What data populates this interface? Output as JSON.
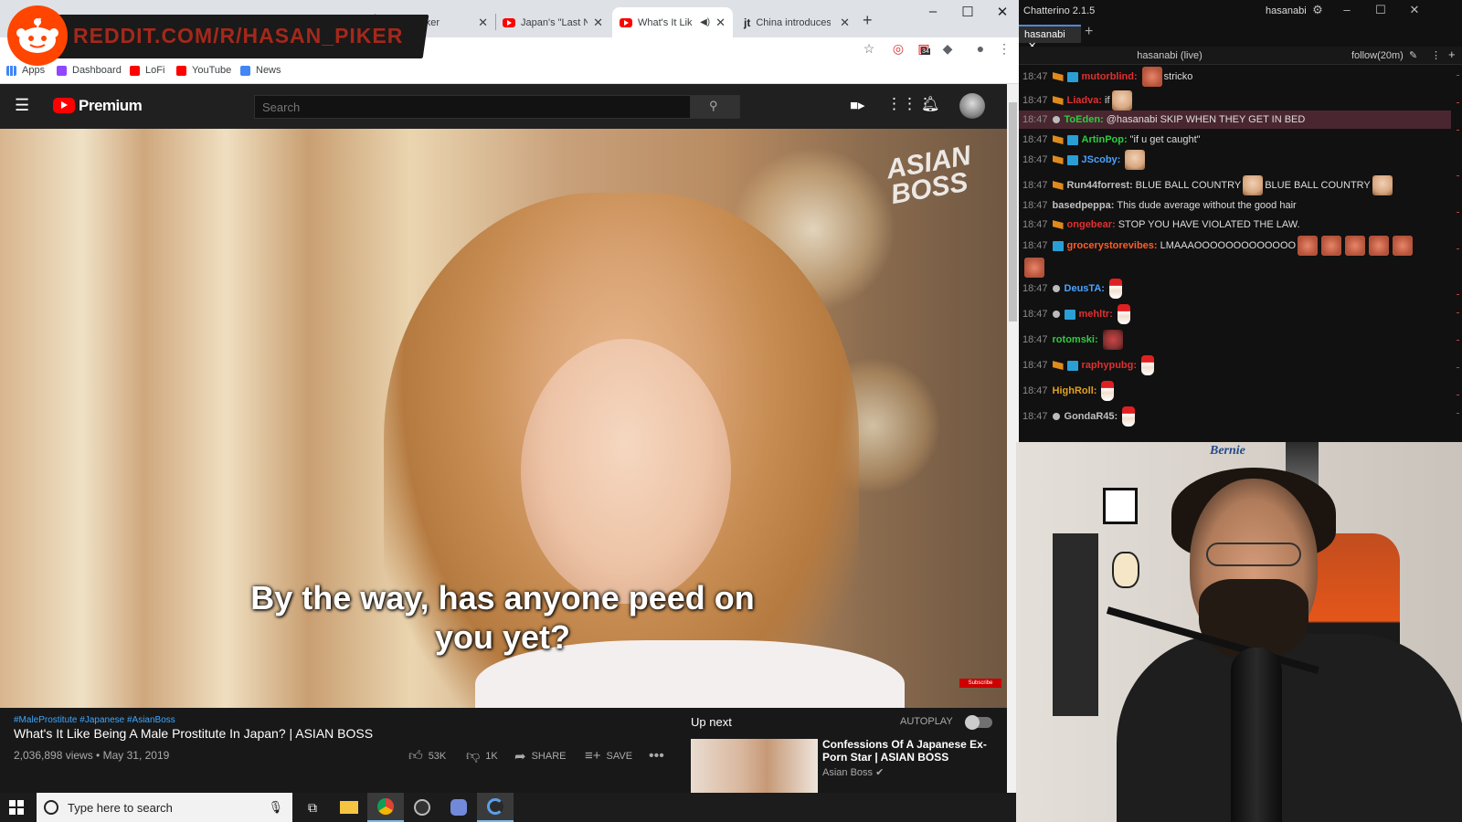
{
  "browser": {
    "tabs": [
      {
        "label": "Piker",
        "icon": "reddit-favicon"
      },
      {
        "label": "Japan's \"Last Ninja",
        "icon": "youtube-favicon"
      },
      {
        "label": "What's It Like",
        "icon": "youtube-favicon",
        "active": true,
        "muted": true
      },
      {
        "label": "China introduces",
        "icon": "jt-favicon"
      }
    ],
    "bookmarks": [
      {
        "label": "Apps",
        "icon": "apps-grid-icon",
        "color": "#4285f4"
      },
      {
        "label": "Dashboard",
        "icon": "twitch-icon",
        "color": "#9146ff"
      },
      {
        "label": "LoFi",
        "icon": "youtube-icon",
        "color": "#ff0000"
      },
      {
        "label": "YouTube",
        "icon": "youtube-icon",
        "color": "#ff0000"
      },
      {
        "label": "News",
        "icon": "google-news-icon",
        "color": "#4285f4"
      }
    ],
    "extension_badge": "34"
  },
  "overlay": {
    "reddit_text": "REDDIT.COM/R/HASAN_PIKER"
  },
  "youtube": {
    "logo_text": "Premium",
    "search_placeholder": "Search",
    "video": {
      "watermark": "ASIAN BOSS",
      "subtitle": "By the way, has anyone peed on you yet?",
      "subscribe_label": "Subscribe",
      "hashtags": "#MaleProstitute #Japanese #AsianBoss",
      "title": "What's It Like Being A Male Prostitute In Japan? | ASIAN BOSS",
      "views": "2,036,898 views • May 31, 2019",
      "likes": "53K",
      "dislikes": "1K",
      "share_label": "SHARE",
      "save_label": "SAVE"
    },
    "up_next": {
      "heading": "Up next",
      "autoplay_label": "AUTOPLAY",
      "autoplay_on": false,
      "item_title": "Confessions Of A Japanese Ex-Porn Star | ASIAN BOSS",
      "item_channel": "Asian Boss"
    }
  },
  "chatterino": {
    "title": "Chatterino 2.1.5",
    "user": "hasanabi",
    "tab": "hasanabi",
    "channel_header": "hasanabi (live)",
    "follow_mode": "follow(20m)",
    "messages": [
      {
        "time": "18:47",
        "nick": "mutorblind:",
        "color": "#e03030",
        "text": "stricko",
        "badges": [
          "sub",
          "prime"
        ],
        "emotes": [
          "rage"
        ]
      },
      {
        "time": "18:47",
        "nick": "Liadva:",
        "color": "#e03030",
        "text": "if",
        "badges": [
          "sub"
        ],
        "emotes_after": [
          "face"
        ]
      },
      {
        "time": "18:47",
        "nick": "ToEden:",
        "color": "#2ecc40",
        "text": "@hasanabi SKIP WHEN THEY GET IN BED",
        "badges": [
          "small"
        ],
        "highlight": true
      },
      {
        "time": "18:47",
        "nick": "ArtinPop:",
        "color": "#2ecc40",
        "text": "\"if u get caught\"",
        "badges": [
          "sub",
          "prime"
        ]
      },
      {
        "time": "18:47",
        "nick": "JScoby:",
        "color": "#4aa3ff",
        "text": "",
        "badges": [
          "sub",
          "prime"
        ],
        "emotes_after": [
          "face"
        ]
      },
      {
        "time": "18:47",
        "nick": "Run44forrest:",
        "color": "#c0c0c0",
        "text": "BLUE BALL COUNTRY",
        "text2": "BLUE BALL COUNTRY",
        "badges": [
          "sub"
        ]
      },
      {
        "time": "18:47",
        "nick": "basedpeppa:",
        "color": "#c0c0c0",
        "text": "This dude average without the good hair",
        "badges": []
      },
      {
        "time": "18:47",
        "nick": "ongebear:",
        "color": "#e03030",
        "text": "STOP YOU HAVE VIOLATED THE LAW.",
        "badges": [
          "sub"
        ]
      },
      {
        "time": "18:47",
        "nick": "grocerystorevibes:",
        "color": "#ff5d2a",
        "text": "LMAAAOOOOOOOOOOOOO",
        "badges": [
          "prime"
        ]
      },
      {
        "time": "18:47",
        "nick": "DeusTA:",
        "color": "#4aa3ff",
        "text": "",
        "badges": [
          "small"
        ]
      },
      {
        "time": "18:47",
        "nick": "mehltr:",
        "color": "#e03030",
        "text": "",
        "badges": [
          "small",
          "prime"
        ]
      },
      {
        "time": "18:47",
        "nick": "rotomski:",
        "color": "#2ecc40",
        "text": "",
        "badges": []
      },
      {
        "time": "18:47",
        "nick": "raphypubg:",
        "color": "#e03030",
        "text": "",
        "badges": [
          "sub",
          "prime"
        ]
      },
      {
        "time": "18:47",
        "nick": "HighRoll:",
        "color": "#e0a020",
        "text": "",
        "badges": []
      },
      {
        "time": "18:47",
        "nick": "GondaR45:",
        "color": "#c0c0c0",
        "text": "",
        "badges": [
          "small"
        ]
      }
    ]
  },
  "webcam": {
    "wall_text": "Bernie"
  },
  "taskbar": {
    "search_placeholder": "Type here to search"
  }
}
